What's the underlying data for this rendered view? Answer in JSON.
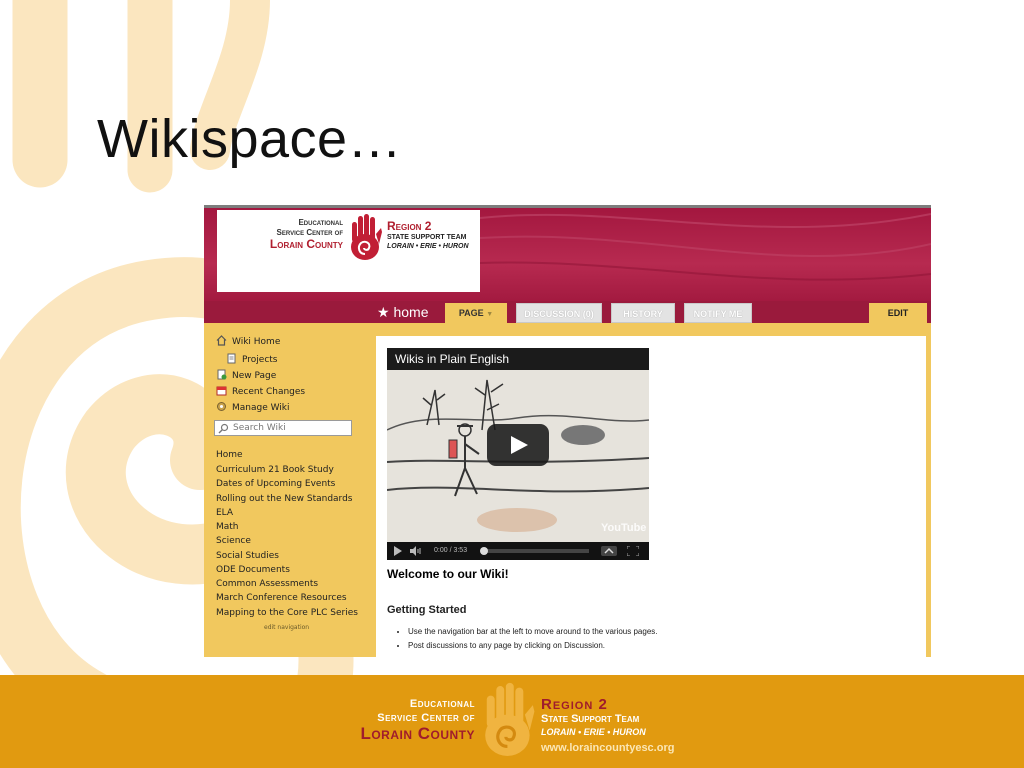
{
  "slide": {
    "title": "Wikispace…",
    "colors": {
      "background_swirl": "#fbe6bf",
      "footer": "#e19a10",
      "brand_red": "#a01c2c"
    }
  },
  "screenshot": {
    "logo": {
      "esc_line1": "Educational",
      "esc_line2": "Service Center of",
      "esc_line3": "Lorain County",
      "region_line1": "Region 2",
      "region_line2": "State Support Team",
      "region_line3": "Lorain • Erie • Huron",
      "icon": "hand-spiral-logo"
    },
    "nav": {
      "home_label": "home",
      "home_icon": "star-icon",
      "tabs": {
        "page": "PAGE",
        "discussion": "DISCUSSION (0)",
        "history": "HISTORY",
        "notify": "NOTIFY ME",
        "edit": "EDIT"
      }
    },
    "sidebar": {
      "tools": [
        {
          "label": "Wiki Home",
          "icon": "house-icon"
        },
        {
          "label": "Projects",
          "icon": "document-icon"
        },
        {
          "label": "New Page",
          "icon": "new-page-icon"
        },
        {
          "label": "Recent Changes",
          "icon": "calendar-icon"
        },
        {
          "label": "Manage Wiki",
          "icon": "gear-icon"
        }
      ],
      "search_placeholder": "Search Wiki",
      "links": [
        "Home",
        "Curriculum 21 Book Study",
        "Dates of Upcoming Events",
        "Rolling out the New Standards",
        "ELA",
        "Math",
        "Science",
        "Social Studies",
        "ODE Documents",
        "Common Assessments",
        "March Conference Resources",
        "Mapping to the Core PLC Series"
      ],
      "edit_navigation": "edit navigation"
    },
    "main": {
      "video": {
        "title": "Wikis in Plain English",
        "time": "0:00 / 3:53",
        "watermark": "YouTube",
        "progress": 0
      },
      "welcome": "Welcome to our Wiki!",
      "section_heading": "Getting Started",
      "bullets": [
        "Use the navigation bar at the left to move around to the various pages.",
        "Post discussions to any page by clicking on Discussion."
      ]
    }
  },
  "footer": {
    "esc_line1": "Educational",
    "esc_line2": "Service Center of",
    "esc_line3": "Lorain County",
    "region_line1": "Region 2",
    "region_line2": "State Support Team",
    "region_line3": "Lorain • Erie • Huron",
    "website": "www.loraincountyesc.org"
  }
}
